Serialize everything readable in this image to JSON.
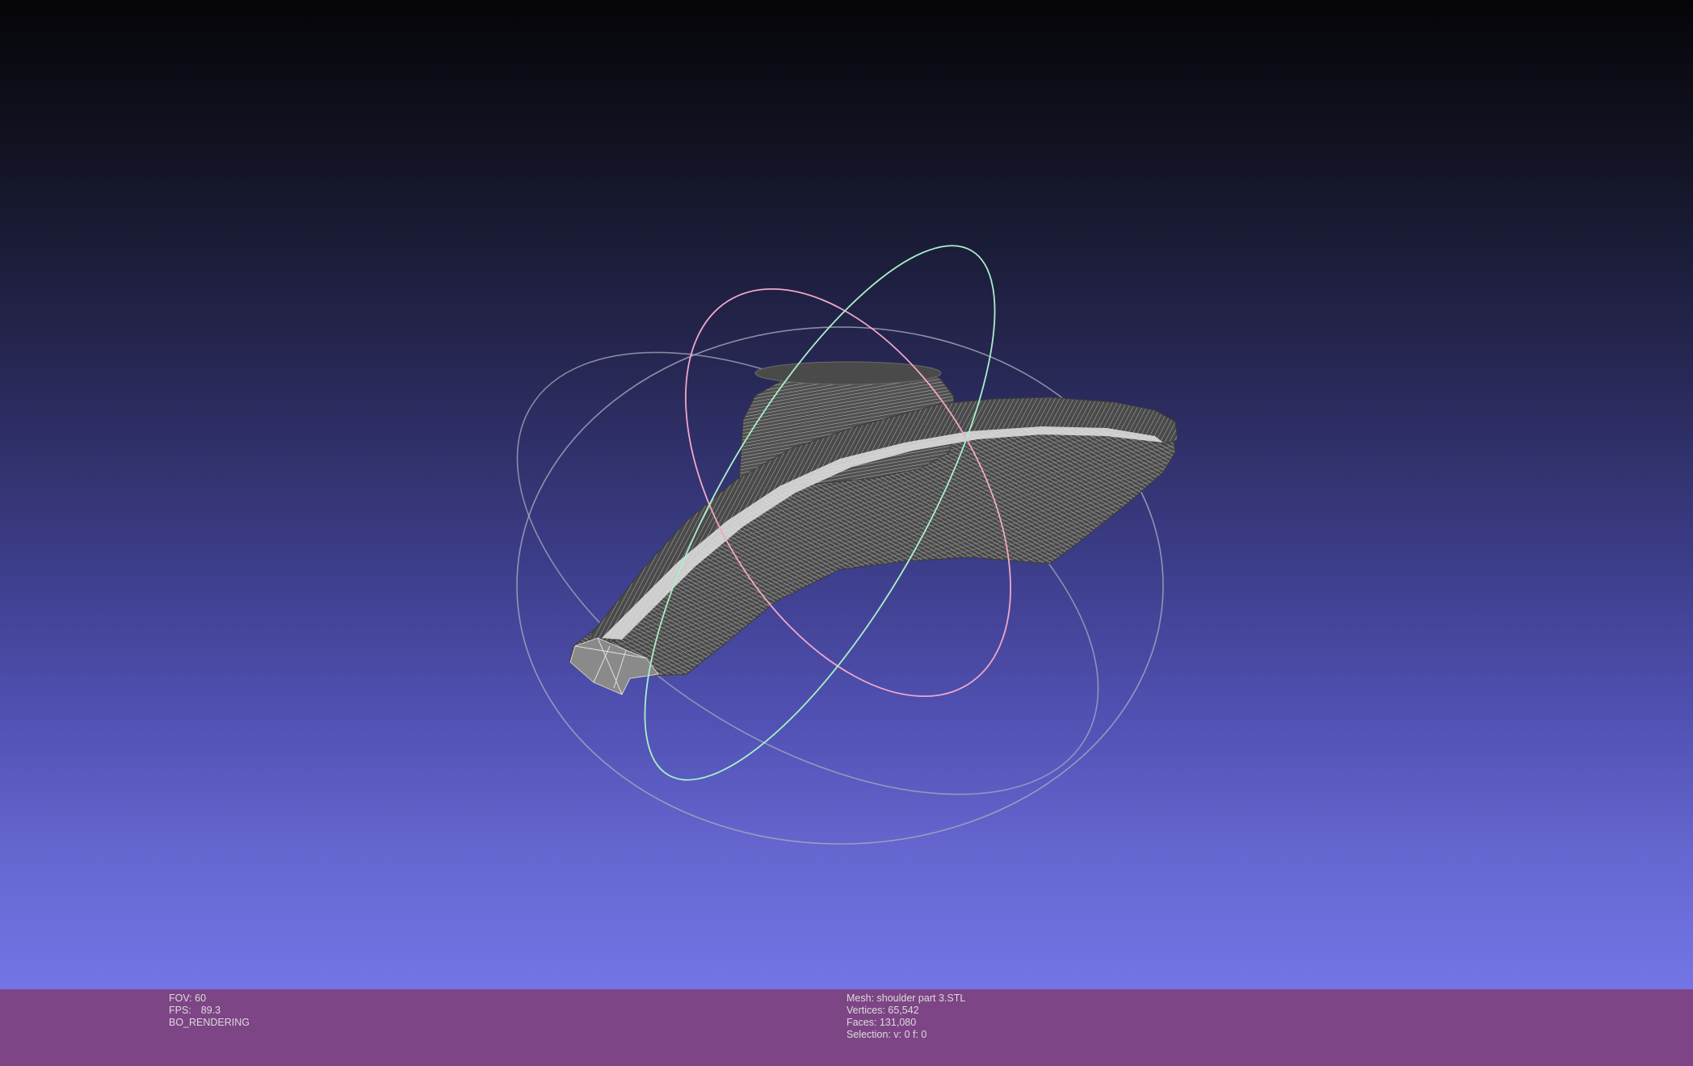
{
  "viewer": {
    "background_top": "#050508",
    "background_bottom": "#7375e6",
    "trackball_colors": {
      "x_ring": "#f0a8c8",
      "y_ring": "#a8f0c8",
      "z_ring": "#b8b8c8"
    },
    "mesh_color": "#5a5a5a",
    "wire_color": "#e8e8e8"
  },
  "status": {
    "bar_color": "#7d4585",
    "fov_label": "FOV: 60",
    "fps_label": "FPS:",
    "fps_value": "89.3",
    "render_mode": "BO_RENDERING",
    "mesh_name": "Mesh: shoulder part 3.STL",
    "vertices": "Vertices: 65,542",
    "faces": "Faces: 131,080",
    "selection": "Selection: v: 0 f: 0"
  }
}
